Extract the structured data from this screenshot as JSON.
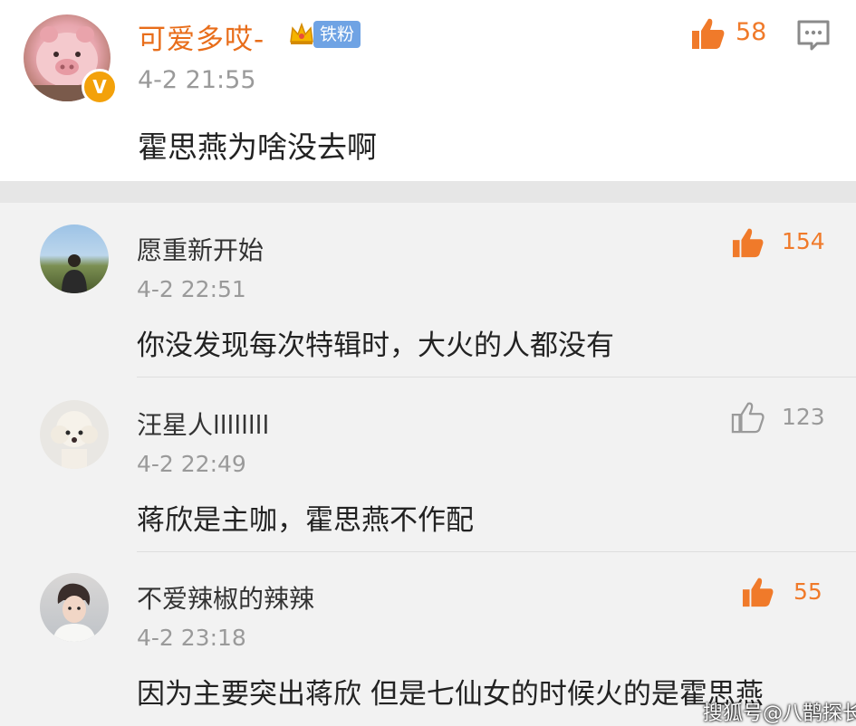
{
  "main_comment": {
    "username": "可爱多哎-",
    "badge": "铁粉",
    "time": "4-2 21:55",
    "text": "霍思燕为啥没去啊",
    "likes": "58",
    "verified_mark": "V"
  },
  "replies": [
    {
      "username": "愿重新开始",
      "time": "4-2 22:51",
      "text": "你没发现每次特辑时，大火的人都没有",
      "likes": "154",
      "liked": true
    },
    {
      "username": "汪星人llllllll",
      "time": "4-2 22:49",
      "text": "蒋欣是主咖，霍思燕不作配",
      "likes": "123",
      "liked": false
    },
    {
      "username": "不爱辣椒的辣辣",
      "time": "4-2 23:18",
      "text": "因为主要突出蒋欣 但是七仙女的时候火的是霍思燕",
      "likes": "55",
      "liked": true
    }
  ],
  "watermark": "搜狐号@八鹊探长",
  "colors": {
    "username_accent": "#e86d1a",
    "like_active": "#f07a2a",
    "like_inactive": "#9a9a9a",
    "badge_bg": "#6fa3e4"
  }
}
